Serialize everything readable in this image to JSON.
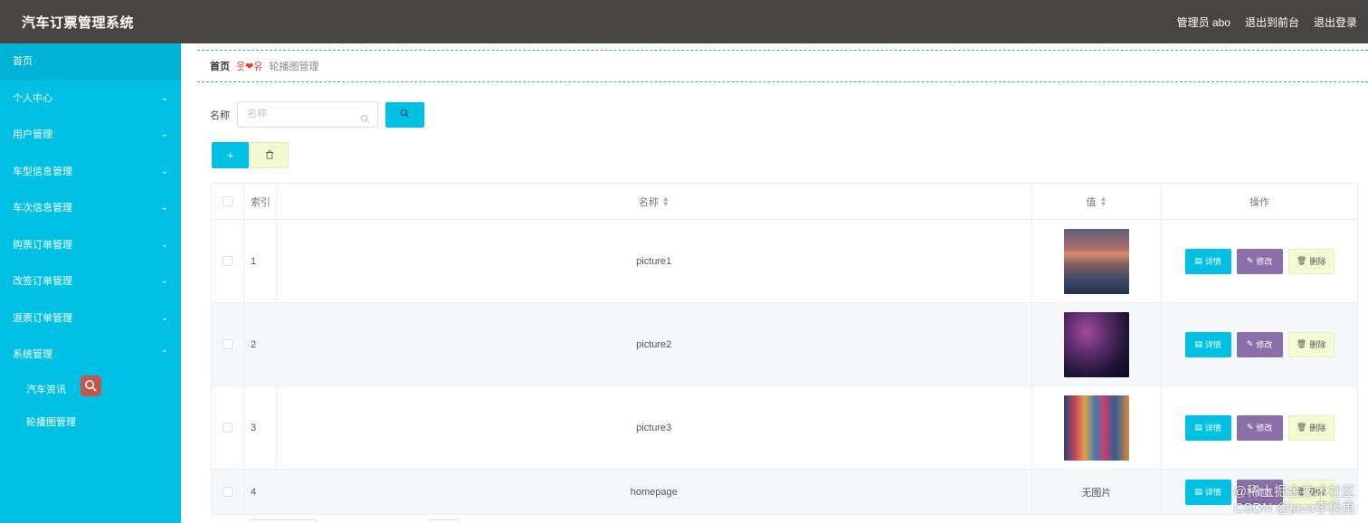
{
  "header": {
    "title": "汽车订票管理系统",
    "user": "管理员 abo",
    "to_front": "退出到前台",
    "logout": "退出登录"
  },
  "sidebar": {
    "items": [
      {
        "label": "首页",
        "active": true
      },
      {
        "label": "个人中心",
        "arrow": "down"
      },
      {
        "label": "用户管理",
        "arrow": "down"
      },
      {
        "label": "车型信息管理",
        "arrow": "down"
      },
      {
        "label": "车次信息管理",
        "arrow": "down"
      },
      {
        "label": "购票订单管理",
        "arrow": "down"
      },
      {
        "label": "改签订单管理",
        "arrow": "down"
      },
      {
        "label": "退票订单管理",
        "arrow": "down"
      },
      {
        "label": "系统管理",
        "arrow": "up"
      }
    ],
    "subitems": [
      "汽车资讯",
      "轮播图管理"
    ]
  },
  "breadcrumb": {
    "home": "首页",
    "separator": "웃❤유",
    "current": "轮播图管理"
  },
  "search": {
    "label": "名称",
    "placeholder": "名称"
  },
  "table": {
    "columns": [
      "索引",
      "名称",
      "值",
      "操作"
    ],
    "rows": [
      {
        "index": "1",
        "name": "picture1",
        "image": "picture"
      },
      {
        "index": "2",
        "name": "picture2",
        "image": "picture"
      },
      {
        "index": "3",
        "name": "picture3",
        "image": "picture"
      },
      {
        "index": "4",
        "name": "homepage",
        "value_text": "无图片"
      }
    ],
    "actions": {
      "detail": "详情",
      "edit": "修改",
      "delete": "删除"
    }
  },
  "watermark": {
    "line1": "@稀土掘金技术社区",
    "line2": "CSDN @java李杨勇"
  },
  "colors": {
    "accent": "#00c0e4",
    "header_bg": "#474543",
    "edit_button": "#8a6fa8",
    "delete_button": "#f4fbd2",
    "breadcrumb_separator": "#e53935"
  }
}
